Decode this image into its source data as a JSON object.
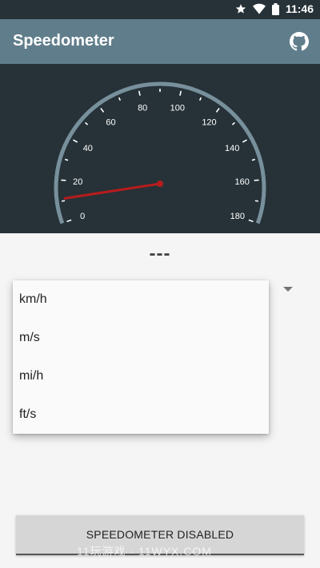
{
  "status_bar": {
    "time": "11:46",
    "icons": [
      "star-icon",
      "wifi-icon",
      "battery-icon"
    ]
  },
  "app_bar": {
    "title": "Speedometer",
    "action_icon": "github-icon"
  },
  "gauge": {
    "min": 0,
    "max": 180,
    "tick_labels": [
      "0",
      "20",
      "40",
      "60",
      "80",
      "100",
      "120",
      "140",
      "160",
      "180"
    ],
    "needle_value": 10,
    "colors": {
      "panel": "#263238",
      "arc": "#78909c",
      "needle": "#b71c1c",
      "text": "#ffffff"
    }
  },
  "readout": {
    "speed": "---"
  },
  "unit_dropdown": {
    "options": [
      "km/h",
      "m/s",
      "mi/h",
      "ft/s"
    ]
  },
  "toggle_button": {
    "label": "SPEEDOMETER DISABLED"
  },
  "watermark": "11玩游戏 · 11WYX.COM",
  "colors": {
    "app_bar": "#607d8b",
    "status_bar": "#263238",
    "background": "#f5f5f5"
  }
}
